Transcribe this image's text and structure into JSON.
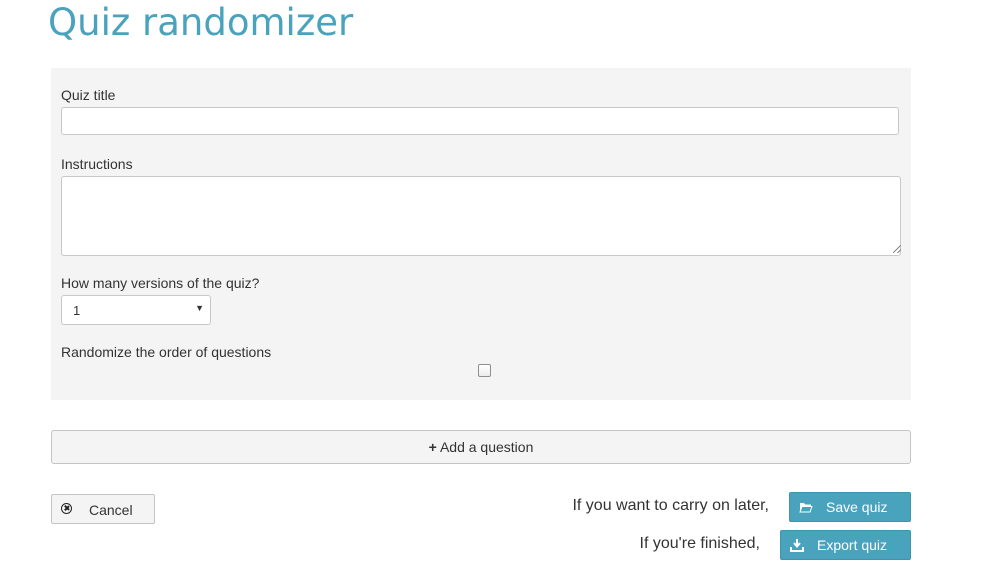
{
  "page": {
    "title": "Quiz randomizer"
  },
  "form": {
    "quiz_title_label": "Quiz title",
    "quiz_title_value": "",
    "instructions_label": "Instructions",
    "instructions_value": "",
    "versions_label": "How many versions of the quiz?",
    "versions_selected": "1",
    "randomize_label": "Randomize the order of questions",
    "randomize_checked": false
  },
  "actions": {
    "add_question_plus": "+",
    "add_question_label": "Add a question",
    "cancel_label": "Cancel",
    "cancel_icon": "circle-x-icon",
    "save_prompt": "If you want to carry on later,",
    "save_label": "Save quiz",
    "save_icon": "folder-open-icon",
    "export_prompt": "If you're finished,",
    "export_label": "Export quiz",
    "export_icon": "download-icon"
  },
  "colors": {
    "accent": "#4aa3bd",
    "panel_background": "#f4f4f4",
    "text": "#333333"
  }
}
